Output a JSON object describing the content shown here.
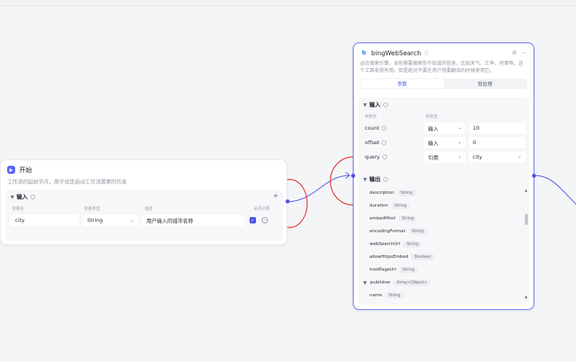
{
  "start_node": {
    "title": "开始",
    "description": "工作流的起始节点，用于设定启动工作流需要的信息",
    "section_title": "输入",
    "columns": {
      "name": "变量名",
      "type": "变量类型",
      "desc": "描述",
      "required": "是否必要"
    },
    "row": {
      "name": "city",
      "type": "String",
      "desc": "用户输入的城市名称",
      "add_symbol": "+"
    }
  },
  "plugin_node": {
    "title": "bingWebSearch",
    "description": "必应搜索引擎。当你需要搜索你不知道的信息，比如天气、汇率、时事等，这个工具非常有用。但是绝对不要在用户想要翻译的时候使用它。",
    "tabs": [
      {
        "label": "参数",
        "active": true
      },
      {
        "label": "批处理",
        "active": false
      }
    ],
    "input_section": {
      "title": "输入",
      "columns": {
        "name": "参数名",
        "value": "参数值"
      },
      "params": [
        {
          "name": "count",
          "mode": "输入",
          "value": "10"
        },
        {
          "name": "offset",
          "mode": "输入",
          "value": "0"
        },
        {
          "name": "query",
          "mode": "引用",
          "value": "city"
        }
      ]
    },
    "output_section": {
      "title": "输出",
      "fields": [
        {
          "name": "description",
          "type": "String"
        },
        {
          "name": "duration",
          "type": "String"
        },
        {
          "name": "embedHtml",
          "type": "String"
        },
        {
          "name": "encodingFormat",
          "type": "String"
        },
        {
          "name": "webSearchUrl",
          "type": "String"
        },
        {
          "name": "allowHttpsEmbed",
          "type": "Boolean"
        },
        {
          "name": "hostPageUrl",
          "type": "String"
        },
        {
          "name": "publisher",
          "type": "Array<Object>"
        },
        {
          "name": "name",
          "type": "String"
        }
      ]
    }
  },
  "colors": {
    "accent": "#4d53e8",
    "annotation": "#e53935"
  }
}
